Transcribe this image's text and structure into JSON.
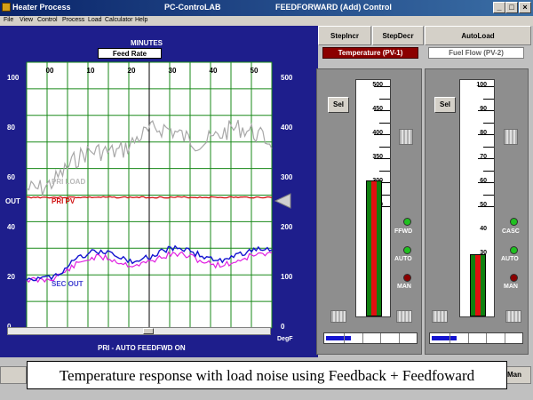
{
  "window": {
    "title_left": "Heater Process",
    "title_center": "PC-ControLAB",
    "title_right": "FEEDFORWARD (Add) Control",
    "minimize": "_",
    "maximize": "□",
    "close": "×"
  },
  "menu": [
    "File",
    "View",
    "Control",
    "Process",
    "Load",
    "Calculator",
    "Help"
  ],
  "toolbar": {
    "step_incr": "StepIncr",
    "step_decr": "StepDecr",
    "auto_load": "AutoLoad"
  },
  "plot": {
    "top_label": "MINUTES",
    "feed_rate_label": "Feed Rate",
    "x_ticks": [
      "00",
      "10",
      "20",
      "30",
      "40",
      "50"
    ],
    "left_ticks": [
      "100",
      "80",
      "60",
      "40",
      "20",
      "0"
    ],
    "right_ticks": [
      "500",
      "400",
      "300",
      "200",
      "100",
      "0"
    ],
    "out_label": "OUT",
    "right_unit": "DegF",
    "series_labels": {
      "pri_load": "PRI LOAD",
      "pri_pv": "PRI PV",
      "sec_out": "SEC OUT"
    },
    "status_line": "PRI - AUTO     FEEDFWD ON",
    "colors": {
      "background": "#1e1e8c",
      "plot_area": "#ffffff",
      "grid": "#1a8a1a",
      "pri_load": "#a8a8a8",
      "pri_pv": "#d01010",
      "sec_out": "#1414d0",
      "magenta": "#e020e0"
    }
  },
  "faceplate_temp": {
    "header": "Temperature  (PV-1)",
    "header_color": "#8b0000",
    "sel_label": "Sel",
    "scale_ticks": [
      "500",
      "450",
      "400",
      "350",
      "300",
      "250"
    ],
    "pv_fraction": 0.57,
    "leds": [
      {
        "label": "FFWD",
        "color": "#20c020"
      },
      {
        "label": "AUTO",
        "color": "#20c020"
      },
      {
        "label": "MAN",
        "color": "#8b0000"
      }
    ],
    "output_fraction": 0.27
  },
  "faceplate_flow": {
    "header": "Fuel Flow  (PV-2)",
    "sel_label": "Sel",
    "scale_ticks": [
      "100",
      "90",
      "80",
      "70",
      "60",
      "50",
      "40",
      "30"
    ],
    "pv_fraction": 0.26,
    "leds": [
      {
        "label": "CASC",
        "color": "#20c020"
      },
      {
        "label": "AUTO",
        "color": "#20c020"
      },
      {
        "label": "MAN",
        "color": "#8b0000"
      }
    ],
    "output_fraction": 0.27
  },
  "bottom_status": {
    "right_button": "Man"
  },
  "caption": "Temperature response with load noise using  Feedback + Feedfoward"
}
